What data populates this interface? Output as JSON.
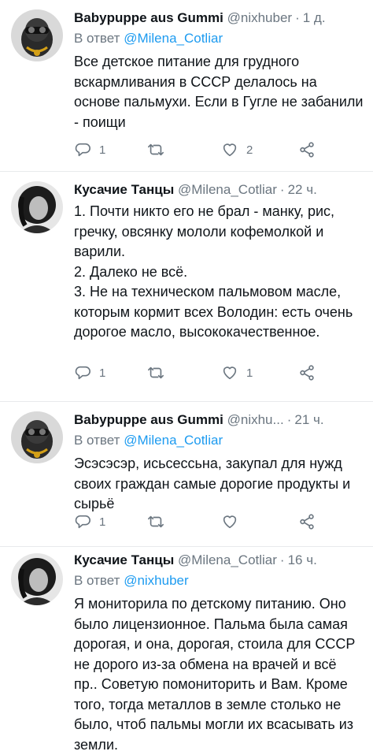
{
  "tweets": [
    {
      "name": "Babypuppe aus Gummi",
      "handle": "@nixhuber",
      "time": "1 д.",
      "reply_prefix": "В ответ",
      "reply_to": "@Milena_Cotliar",
      "lines": [
        "Все детское питание для грудного вскармливания в СССР делалось на основе пальмухи. Если в Гугле не забанили - поищи"
      ],
      "replies": "1",
      "retweets": "",
      "likes": "2"
    },
    {
      "name": "Кусачие Танцы",
      "handle": "@Milena_Cotliar",
      "time": "22 ч.",
      "reply_prefix": "",
      "reply_to": "",
      "lines": [
        "1. Почти никто его не брал - манку, рис, гречку, овсянку мололи кофемолкой и варили.",
        "2. Далеко не всё.",
        "3. Не на техническом пальмовом масле, которым кормит всех Володин: есть очень дорогое масло, высококачественное."
      ],
      "replies": "1",
      "retweets": "",
      "likes": "1"
    },
    {
      "name": "Babypuppe aus Gummi",
      "handle": "@nixhu...",
      "time": "21 ч.",
      "reply_prefix": "В ответ",
      "reply_to": "@Milena_Cotliar",
      "lines": [
        "Эсэсэсэр, исьсессьна, закупал для нужд своих граждан самые дорогие продукты и сырьё"
      ],
      "replies": "1",
      "retweets": "",
      "likes": ""
    },
    {
      "name": "Кусачие Танцы",
      "handle": "@Milena_Cotliar",
      "time": "16 ч.",
      "reply_prefix": "В ответ",
      "reply_to": "@nixhuber",
      "lines": [
        "Я мониторила по детскому питанию. Оно было лицензионное. Пальма была самая дорогая, и она, дорогая, стоила для СССР не дорого из-за обмена на врачей и всё пр.. Советую помониторить и Вам. Кроме того, тогда металлов в земле столько не было, чтоб пальмы могли их всасывать из земли."
      ],
      "replies": "",
      "retweets": "",
      "likes": ""
    }
  ]
}
